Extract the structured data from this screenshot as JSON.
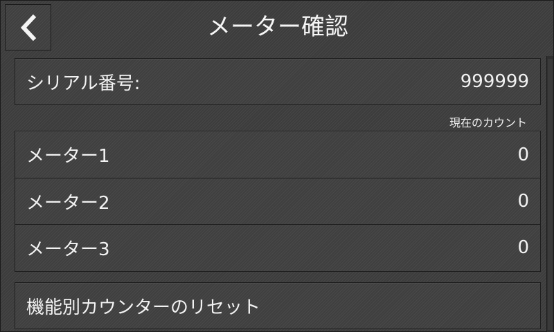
{
  "header": {
    "title": "メーター確認",
    "back_icon": "chevron-left-icon"
  },
  "serial": {
    "label": "シリアル番号:",
    "value": "999999"
  },
  "counter_caption": "現在のカウント",
  "meters": [
    {
      "label": "メーター1",
      "value": "0"
    },
    {
      "label": "メーター2",
      "value": "0"
    },
    {
      "label": "メーター3",
      "value": "0"
    }
  ],
  "reset": {
    "label": "機能別カウンターのリセット"
  },
  "colors": {
    "background": "#404040",
    "border": "#1f1f1f",
    "text": "#f2f2f2"
  }
}
